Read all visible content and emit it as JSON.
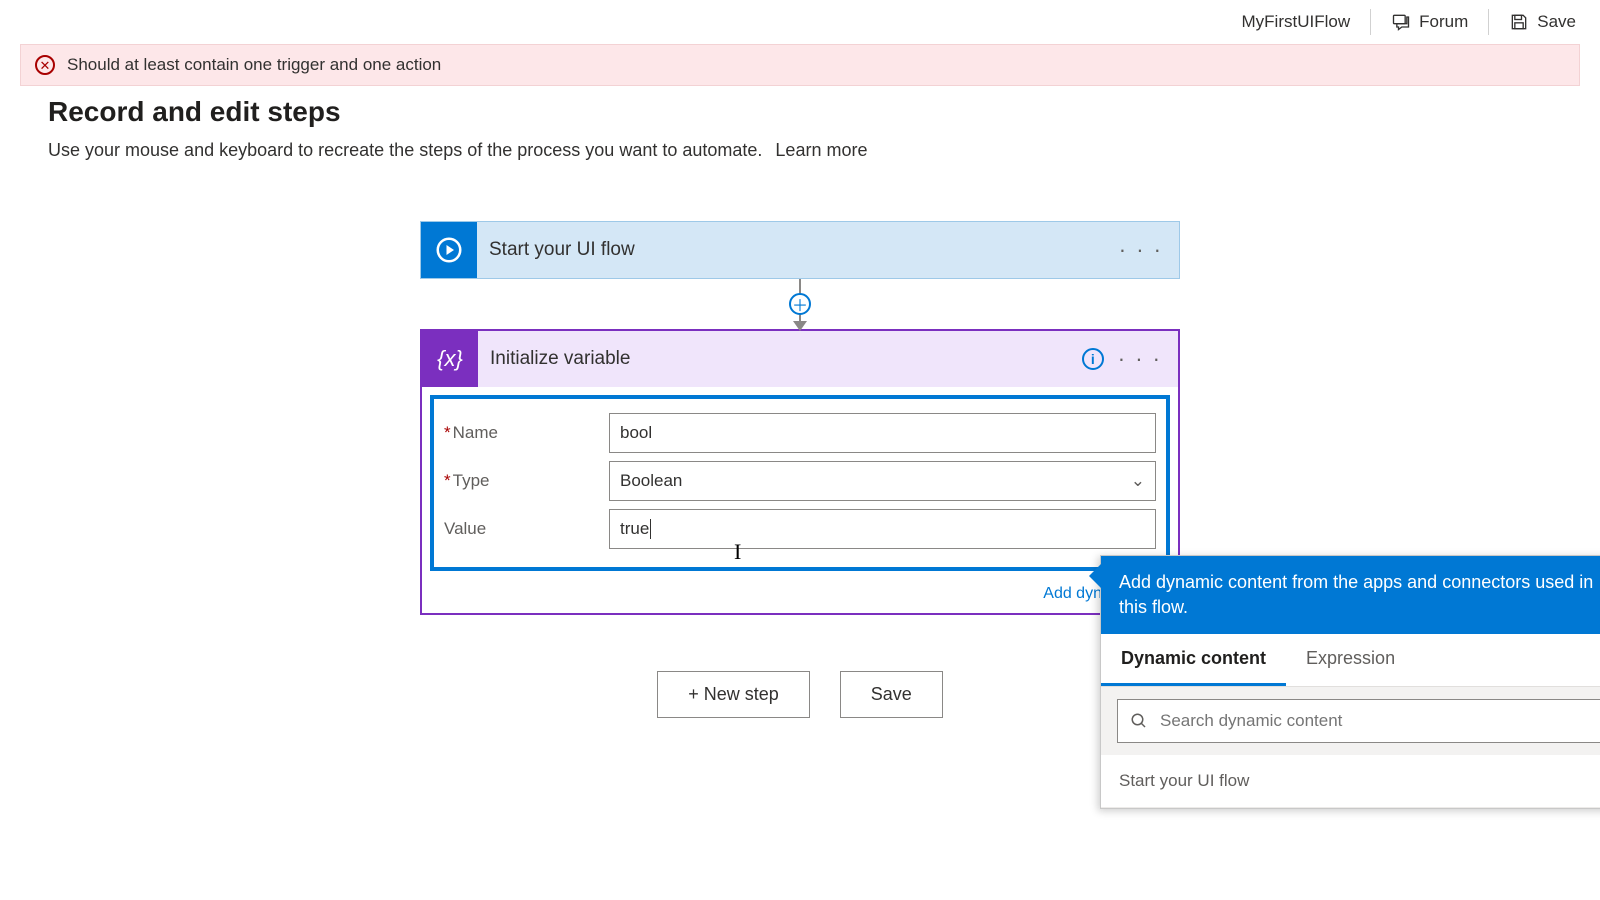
{
  "topbar": {
    "title": "MyFirstUIFlow",
    "forum": "Forum",
    "save": "Save"
  },
  "banner": {
    "message": "Should at least contain one trigger and one action"
  },
  "page": {
    "heading": "Record and edit steps",
    "subtitle": "Use your mouse and keyboard to recreate the steps of the process you want to automate.",
    "learn_more": "Learn more"
  },
  "steps": {
    "start": {
      "title": "Start your UI flow"
    },
    "init_var": {
      "title": "Initialize variable",
      "fields": {
        "name_label": "Name",
        "name_value": "bool",
        "type_label": "Type",
        "type_value": "Boolean",
        "value_label": "Value",
        "value_value": "true"
      },
      "add_dynamic": "Add dynamic con"
    }
  },
  "buttons": {
    "new_step": "+ New step",
    "save": "Save"
  },
  "popup": {
    "header": "Add dynamic content from the apps and connectors used in this flow.",
    "tabs": {
      "dynamic": "Dynamic content",
      "expression": "Expression"
    },
    "search_placeholder": "Search dynamic content",
    "section1": "Start your UI flow"
  }
}
